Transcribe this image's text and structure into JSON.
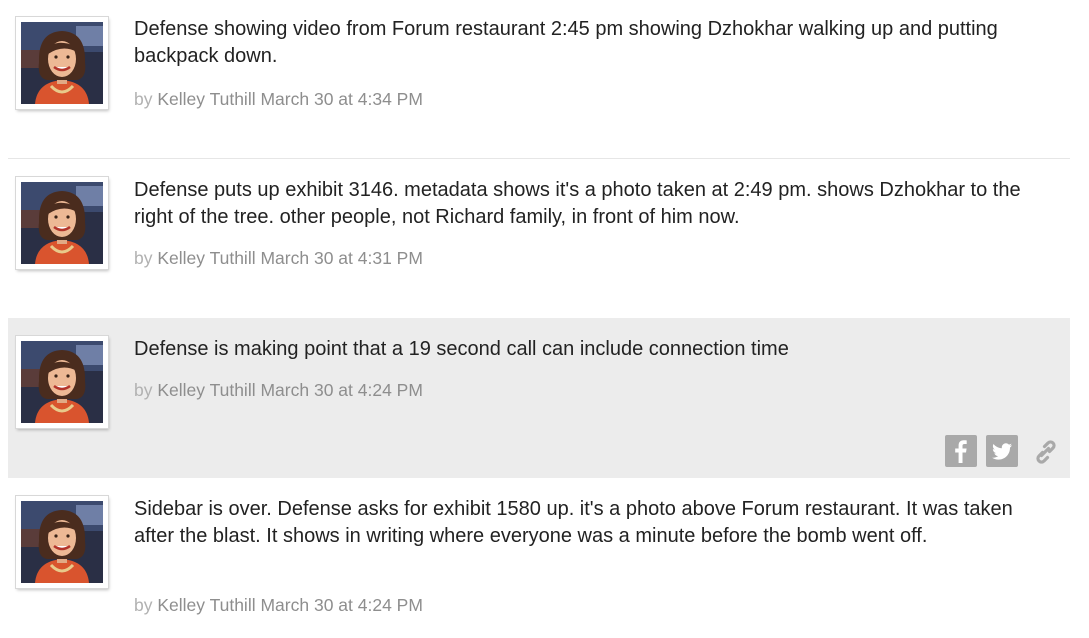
{
  "entries": [
    {
      "text": "Defense showing video from Forum restaurant 2:45 pm showing Dzhokhar walking up and putting backpack down.",
      "by": "by",
      "author": "Kelley Tuthill",
      "time": "March 30 at 4:34 PM"
    },
    {
      "text": "Defense puts up exhibit 3146. metadata shows it's a photo taken at 2:49 pm. shows Dzhokhar to the right of the tree. other people, not Richard family, in front of him now.",
      "by": "by",
      "author": "Kelley Tuthill",
      "time": "March 30 at 4:31 PM"
    },
    {
      "text": "Defense is making point that a 19 second call can include connection time",
      "by": "by",
      "author": "Kelley Tuthill",
      "time": "March 30 at 4:24 PM"
    },
    {
      "text": "Sidebar is over. Defense asks for exhibit 1580 up. it's a photo above Forum restaurant. It was taken after the blast. It shows in writing where everyone was a minute before the bomb went off.",
      "by": "by",
      "author": "Kelley Tuthill",
      "time": "March 30 at 4:24 PM"
    }
  ],
  "share_icons": [
    "facebook-icon",
    "twitter-icon",
    "link-icon"
  ],
  "colors": {
    "highlight_bg": "#ececec",
    "body_text": "#222222",
    "meta_text": "#8e8e8e",
    "icon_gray": "#a9a9a9"
  }
}
